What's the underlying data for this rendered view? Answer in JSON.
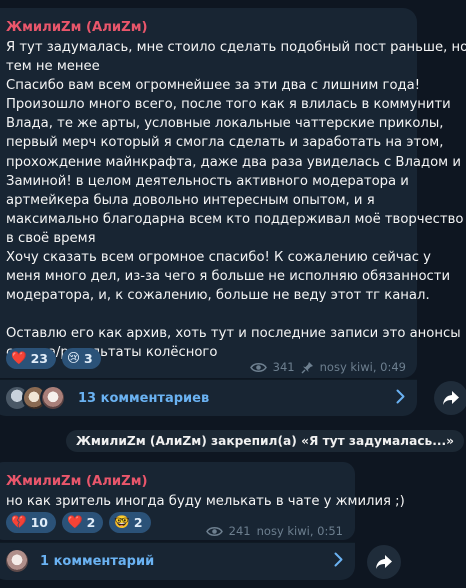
{
  "posts": [
    {
      "author": "ЖмилиZм (АлиZм)",
      "lines": [
        "Я тут задумалась, мне стоило сделать подобный пост раньше, но",
        "тем не менее",
        "Спасибо вам всем огромнейшее за эти два с лишним года!",
        "Произошло много всего, после того как я влилась в коммунити",
        "Влада, те же арты, условные локальные чаттерские приколы,",
        "первый мерч который я смогла сделать и заработать на этом,",
        "прохождение майнкрафта, даже два раза увиделась с Владом и",
        "Заминой! в целом деятельность активного модератора и",
        "артмейкера была довольно интересным опытом, и я",
        "максимально благодарна всем кто поддерживал моё творчество",
        "в своё время",
        "Хочу сказать всем огромное спасибо! К сожалению сейчас у",
        "меня много дел, из-за чего я больше не исполняю обязанности",
        "модератора, и, к сожалению, больше не веду этот тг канал.",
        "",
        "Оставлю его как архив, хоть тут и последние записи это анонсы",
        "стрима/результаты колёсного"
      ],
      "reactions": [
        {
          "emoji": "❤️",
          "icon": "heart-icon",
          "count": "23"
        },
        {
          "emoji": "😢",
          "icon": "crying-face-icon",
          "count": "3"
        }
      ],
      "views": "341",
      "signature": "nosy kiwi, 0:49",
      "comments_label": "13 комментариев"
    },
    {
      "author": "ЖмилиZм (АлиZм)",
      "lines": [
        "но как зритель иногда буду мелькать в чате у жмилия ;)"
      ],
      "reactions": [
        {
          "emoji": "💔",
          "icon": "broken-heart-icon",
          "count": "10"
        },
        {
          "emoji": "❤️",
          "icon": "heart-icon",
          "count": "2"
        },
        {
          "emoji": "🤓",
          "icon": "nerd-face-icon",
          "count": "2"
        }
      ],
      "views": "241",
      "signature": "nosy kiwi, 0:51",
      "comments_label": "1 комментарий"
    }
  ],
  "service_message": "ЖмилиZм (АлиZм) закрепил(а) «Я тут задумалась...»",
  "colors": {
    "background": "#0e1621",
    "bubble": "#182533",
    "author": "#e9566b",
    "link": "#6ab2f2",
    "reaction_bg": "#2b5278"
  }
}
